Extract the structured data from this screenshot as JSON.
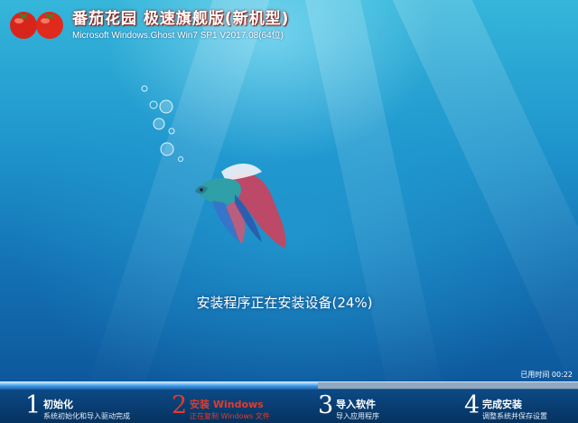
{
  "brand": {
    "title": "番茄花园 极速旗舰版(新机型)",
    "subtitle": "Microsoft Windows.Ghost Win7 SP1 V2017.08(64位)"
  },
  "install": {
    "status_text": "安装程序正在安装设备(24%)",
    "elapsed_text": "已用时间 00:22",
    "overall_progress": 0.55
  },
  "steps": [
    {
      "number": "1",
      "title": "初始化",
      "desc": "系统初始化和导入驱动完成"
    },
    {
      "number": "2",
      "title": "安装 Windows",
      "desc": "正在复制 Windows 文件",
      "active": true
    },
    {
      "number": "3",
      "title": "导入软件",
      "desc": "导入应用程序"
    },
    {
      "number": "4",
      "title": "完成安装",
      "desc": "调整系统并保存设置"
    }
  ],
  "colors": {
    "active_step": "#e23b2b",
    "progress": "#3b9be8",
    "background": "#1e94cc"
  },
  "icons": {
    "logo": "tomato-logo-icon",
    "fish": "betta-fish-illustration"
  }
}
